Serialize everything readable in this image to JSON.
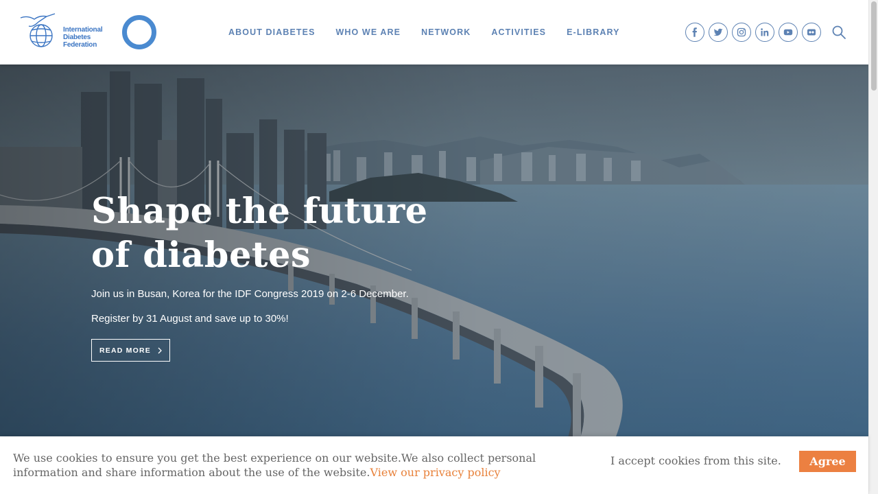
{
  "brand": {
    "name_lines": [
      "International",
      "Diabetes",
      "Federation"
    ],
    "logo_color": "#3a74c2",
    "ring_color": "#4a8ad0"
  },
  "nav": {
    "items": [
      {
        "label": "ABOUT DIABETES"
      },
      {
        "label": "WHO WE ARE"
      },
      {
        "label": "NETWORK"
      },
      {
        "label": "ACTIVITIES"
      },
      {
        "label": "E-LIBRARY"
      }
    ]
  },
  "social": {
    "icons": [
      "facebook-icon",
      "twitter-icon",
      "instagram-icon",
      "linkedin-icon",
      "youtube-icon",
      "flickr-icon"
    ],
    "search_icon": "search-icon"
  },
  "hero": {
    "title_line1": "Shape the future",
    "title_line2": "of diabetes",
    "paragraph1": "Join us in Busan, Korea for the IDF Congress 2019 on 2-6 December.",
    "paragraph2": "Register by 31 August and save up to 30%!",
    "button_label": "READ MORE"
  },
  "cookie": {
    "text": "We use cookies to ensure you get the best experience on our website.We also collect personal information and share information about the use of the website.",
    "link_text": "View our privacy policy",
    "accept_text": "I accept cookies from this site.",
    "agree_label": "Agree",
    "accent_color": "#ec8041"
  }
}
